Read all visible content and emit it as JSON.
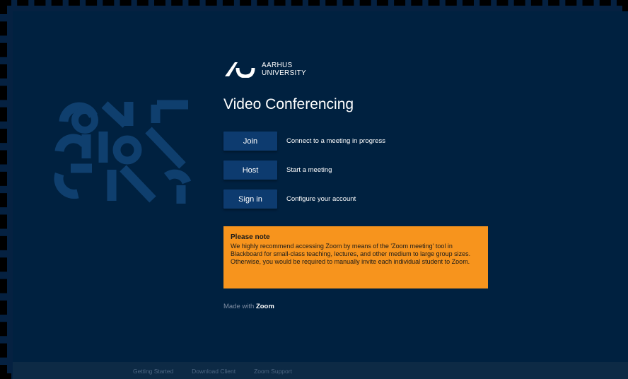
{
  "logo": {
    "line1": "AARHUS",
    "line2": "UNIVERSITY",
    "icon": "aarhus-university-logo"
  },
  "page": {
    "title": "Video Conferencing"
  },
  "actions": [
    {
      "label": "Join",
      "description": "Connect to a meeting in progress"
    },
    {
      "label": "Host",
      "description": "Start a meeting"
    },
    {
      "label": "Sign in",
      "description": "Configure your account"
    }
  ],
  "note": {
    "title": "Please note",
    "body": "We highly recommend accessing Zoom by means of the 'Zoom meeting' tool in Blackboard for small-class teaching, lectures, and other medium to large group sizes. Otherwise, you would be required to manually invite each individual student to Zoom."
  },
  "made_with": {
    "prefix": "Made with",
    "brand": "Zoom"
  },
  "footer": {
    "links": [
      "Getting Started",
      "Download Client",
      "Zoom Support"
    ]
  },
  "colors": {
    "background": "#002140",
    "button": "#0d3b6f",
    "note": "#f7941d",
    "pattern": "#0f3f6e"
  }
}
